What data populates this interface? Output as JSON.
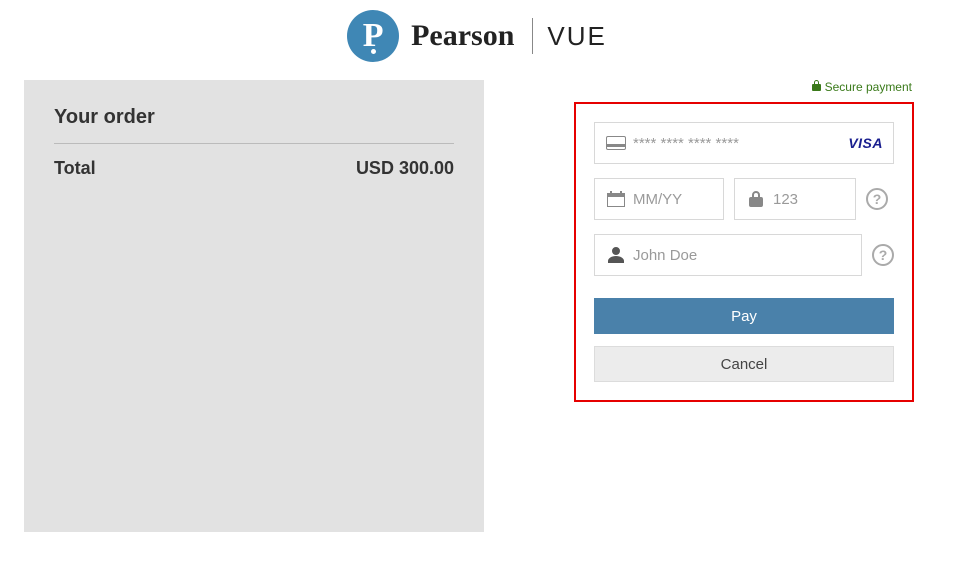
{
  "brand": {
    "pearson": "Pearson",
    "vue": "VUE"
  },
  "secure_label": "Secure payment",
  "order": {
    "title": "Your order",
    "total_label": "Total",
    "total_value": "USD 300.00"
  },
  "payment": {
    "card_placeholder": "**** **** **** ****",
    "card_brand": "VISA",
    "expiry_placeholder": "MM/YY",
    "cvv_placeholder": "123",
    "name_placeholder": "John Doe",
    "pay_label": "Pay",
    "cancel_label": "Cancel"
  }
}
